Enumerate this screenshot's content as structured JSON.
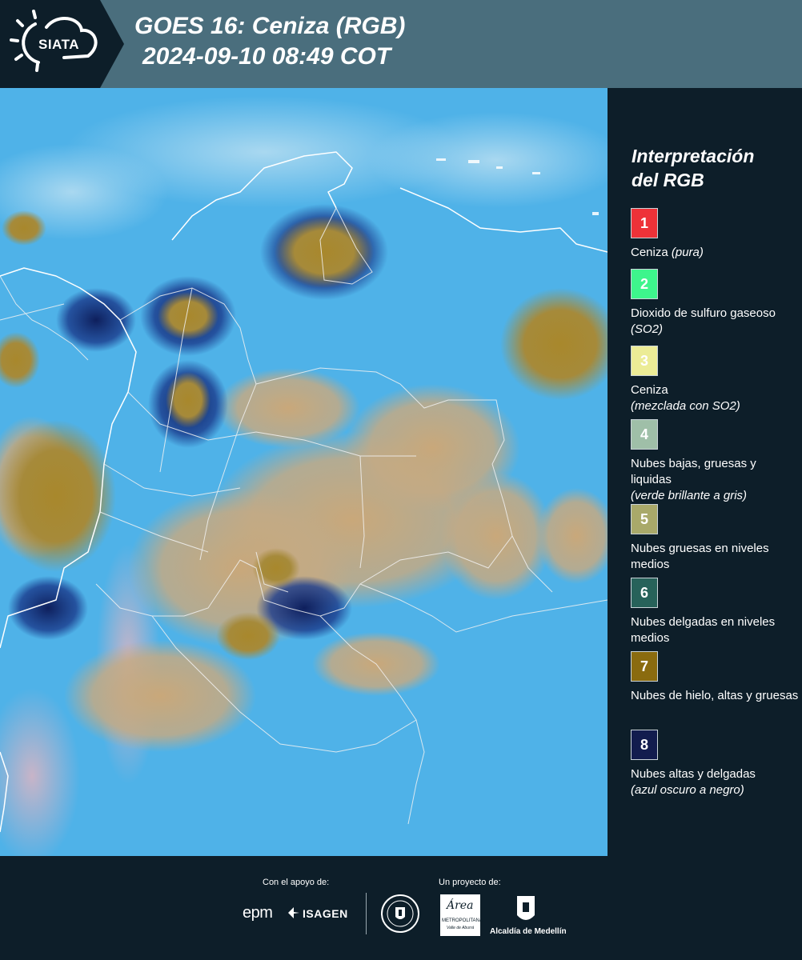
{
  "header": {
    "logo_text": "SIATA",
    "title_line1": "GOES 16: Ceniza (RGB)",
    "title_line2": "2024-09-10 08:49 COT"
  },
  "legend": {
    "title_line1": "Interpretación",
    "title_line2": "del RGB",
    "items": [
      {
        "number": "1",
        "color": "#ee3238",
        "label": "Ceniza",
        "sublabel": "(pura)"
      },
      {
        "number": "2",
        "color": "#3ef58c",
        "label": "Dioxido de sulfuro gaseoso",
        "sublabel": "(SO2)"
      },
      {
        "number": "3",
        "color": "#ecec96",
        "label": "Ceniza",
        "sublabel": "(mezclada con SO2)"
      },
      {
        "number": "4",
        "color": "#9fbfa8",
        "label": "Nubes bajas, gruesas y liquidas",
        "sublabel": "(verde brillante a gris)"
      },
      {
        "number": "5",
        "color": "#a9a96a",
        "label": "Nubes gruesas en niveles medios",
        "sublabel": ""
      },
      {
        "number": "6",
        "color": "#27625a",
        "label": "Nubes delgadas en niveles medios",
        "sublabel": ""
      },
      {
        "number": "7",
        "color": "#8a6b0f",
        "label": "Nubes de hielo, altas y gruesas",
        "sublabel": ""
      },
      {
        "number": "8",
        "color": "#121c4e",
        "label": "Nubes altas y delgadas",
        "sublabel": "(azul oscuro a negro)"
      }
    ]
  },
  "footer": {
    "support_label": "Con el apoyo de:",
    "project_label": "Un proyecto de:",
    "sponsor_epm": "epm",
    "sponsor_isagen": "ISAGEN",
    "sponsor_area_line1": "Área",
    "sponsor_area_line2": "METROPOLITANA",
    "sponsor_area_line3": "Valle de Aburrá",
    "sponsor_alcaldia": "Alcaldía de Medellín"
  },
  "colors": {
    "header_bg": "#4a6e7d",
    "panel_bg": "#0d1e29",
    "map_sky": "#4fb2e8",
    "cloud_tan": "#c9a87a",
    "cloud_ice": "#a8882c",
    "cloud_thin": "#0e1f5c"
  }
}
